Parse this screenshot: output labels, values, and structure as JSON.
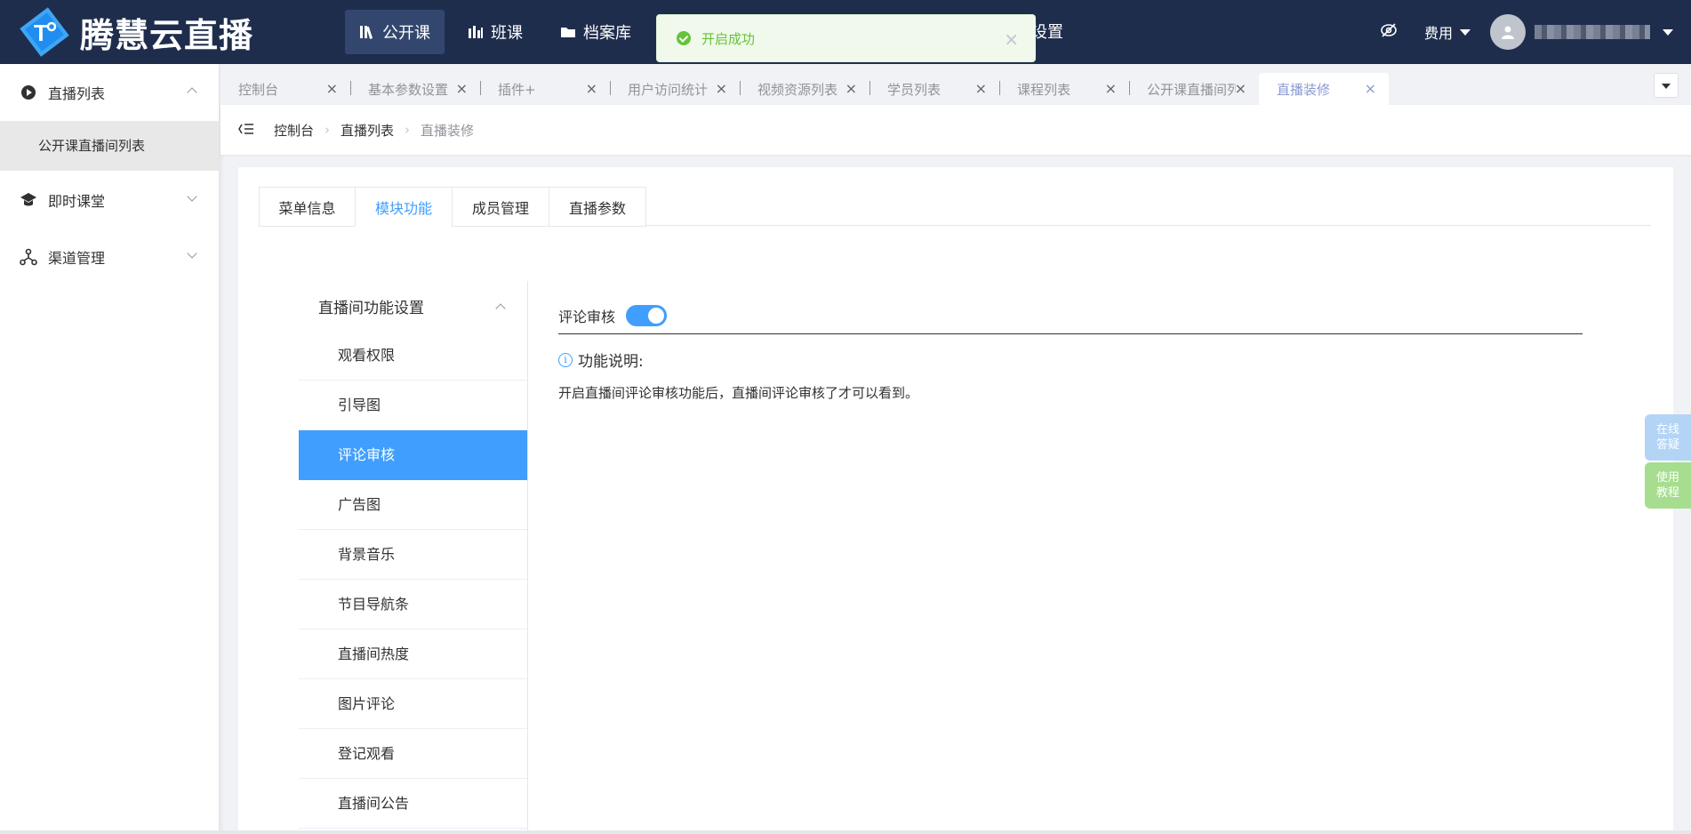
{
  "brand": {
    "name": "腾慧云直播",
    "logo_mark": "T°"
  },
  "topnav": [
    {
      "label": "公开课",
      "icon": "library-icon",
      "active": true
    },
    {
      "label": "班课",
      "icon": "chart-bars-icon",
      "active": false
    },
    {
      "label": "档案库",
      "icon": "folder-icon",
      "active": false
    }
  ],
  "topnav_partial": "设置",
  "top_right": {
    "fee_label": "费用"
  },
  "toast": {
    "message": "开启成功"
  },
  "sidebar": {
    "groups": [
      {
        "label": "直播列表",
        "icon": "live-list-icon",
        "expanded": true,
        "children": [
          "公开课直播间列表"
        ]
      },
      {
        "label": "即时课堂",
        "icon": "classroom-icon",
        "expanded": false
      },
      {
        "label": "渠道管理",
        "icon": "channel-icon",
        "expanded": false
      }
    ]
  },
  "tabs": [
    {
      "label": "控制台"
    },
    {
      "label": "基本参数设置"
    },
    {
      "label": "插件+"
    },
    {
      "label": "用户访问统计"
    },
    {
      "label": "视频资源列表"
    },
    {
      "label": "学员列表"
    },
    {
      "label": "课程列表"
    },
    {
      "label": "公开课直播间列"
    },
    {
      "label": "直播装修",
      "active": true
    }
  ],
  "breadcrumb": [
    "控制台",
    "直播列表",
    "直播装修"
  ],
  "content_tabs": [
    {
      "label": "菜单信息"
    },
    {
      "label": "模块功能",
      "active": true
    },
    {
      "label": "成员管理"
    },
    {
      "label": "直播参数"
    }
  ],
  "function_menu": {
    "header": "直播间功能设置",
    "items": [
      "观看权限",
      "引导图",
      "评论审核",
      "广告图",
      "背景音乐",
      "节目导航条",
      "直播间热度",
      "图片评论",
      "登记观看",
      "直播间公告"
    ],
    "active_index": 2
  },
  "setting": {
    "label": "评论审核",
    "enabled": true,
    "desc_title": "功能说明:",
    "desc_text": "开启直播间评论审核功能后，直播间评论审核了才可以看到。"
  },
  "float_buttons": {
    "help": "在线答疑",
    "guide": "使用教程"
  },
  "colors": {
    "topbar": "#1f2d4d",
    "accent": "#409eff",
    "success": "#67c23a"
  }
}
